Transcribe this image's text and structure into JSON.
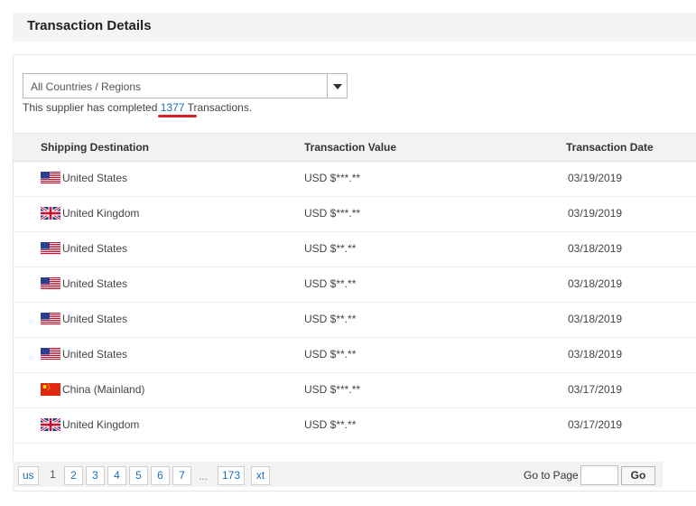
{
  "header": {
    "title": "Transaction Details"
  },
  "filter": {
    "selected": "All Countries / Regions"
  },
  "summary": {
    "prefix": "This supplier has completed ",
    "count": "1377",
    "suffix": " Transactions."
  },
  "table": {
    "columns": [
      "Shipping Destination",
      "Transaction Value",
      "Transaction Date"
    ],
    "rows": [
      {
        "flag": "us-flag-icon",
        "destination": "United States",
        "value": "USD $***.**",
        "date": "03/19/2019"
      },
      {
        "flag": "uk-flag-icon",
        "destination": "United Kingdom",
        "value": "USD $***.**",
        "date": "03/19/2019"
      },
      {
        "flag": "us-flag-icon",
        "destination": "United States",
        "value": "USD $**.**",
        "date": "03/18/2019"
      },
      {
        "flag": "us-flag-icon",
        "destination": "United States",
        "value": "USD $**.**",
        "date": "03/18/2019"
      },
      {
        "flag": "us-flag-icon",
        "destination": "United States",
        "value": "USD $**.**",
        "date": "03/18/2019"
      },
      {
        "flag": "us-flag-icon",
        "destination": "United States",
        "value": "USD $**.**",
        "date": "03/18/2019"
      },
      {
        "flag": "cn-flag-icon",
        "destination": "China (Mainland)",
        "value": "USD $***.**",
        "date": "03/17/2019"
      },
      {
        "flag": "uk-flag-icon",
        "destination": "United Kingdom",
        "value": "USD $**.**",
        "date": "03/17/2019"
      }
    ]
  },
  "pagination": {
    "prev_label": "us",
    "current": "1",
    "pages": [
      "2",
      "3",
      "4",
      "5",
      "6",
      "7"
    ],
    "ellipsis": "...",
    "last": "173",
    "next_label": "xt",
    "goto_label": "Go to Page",
    "goto_value": "",
    "go_label": "Go"
  },
  "colors": {
    "link": "#1a6fb8",
    "annotation_underline": "#d8202a"
  }
}
